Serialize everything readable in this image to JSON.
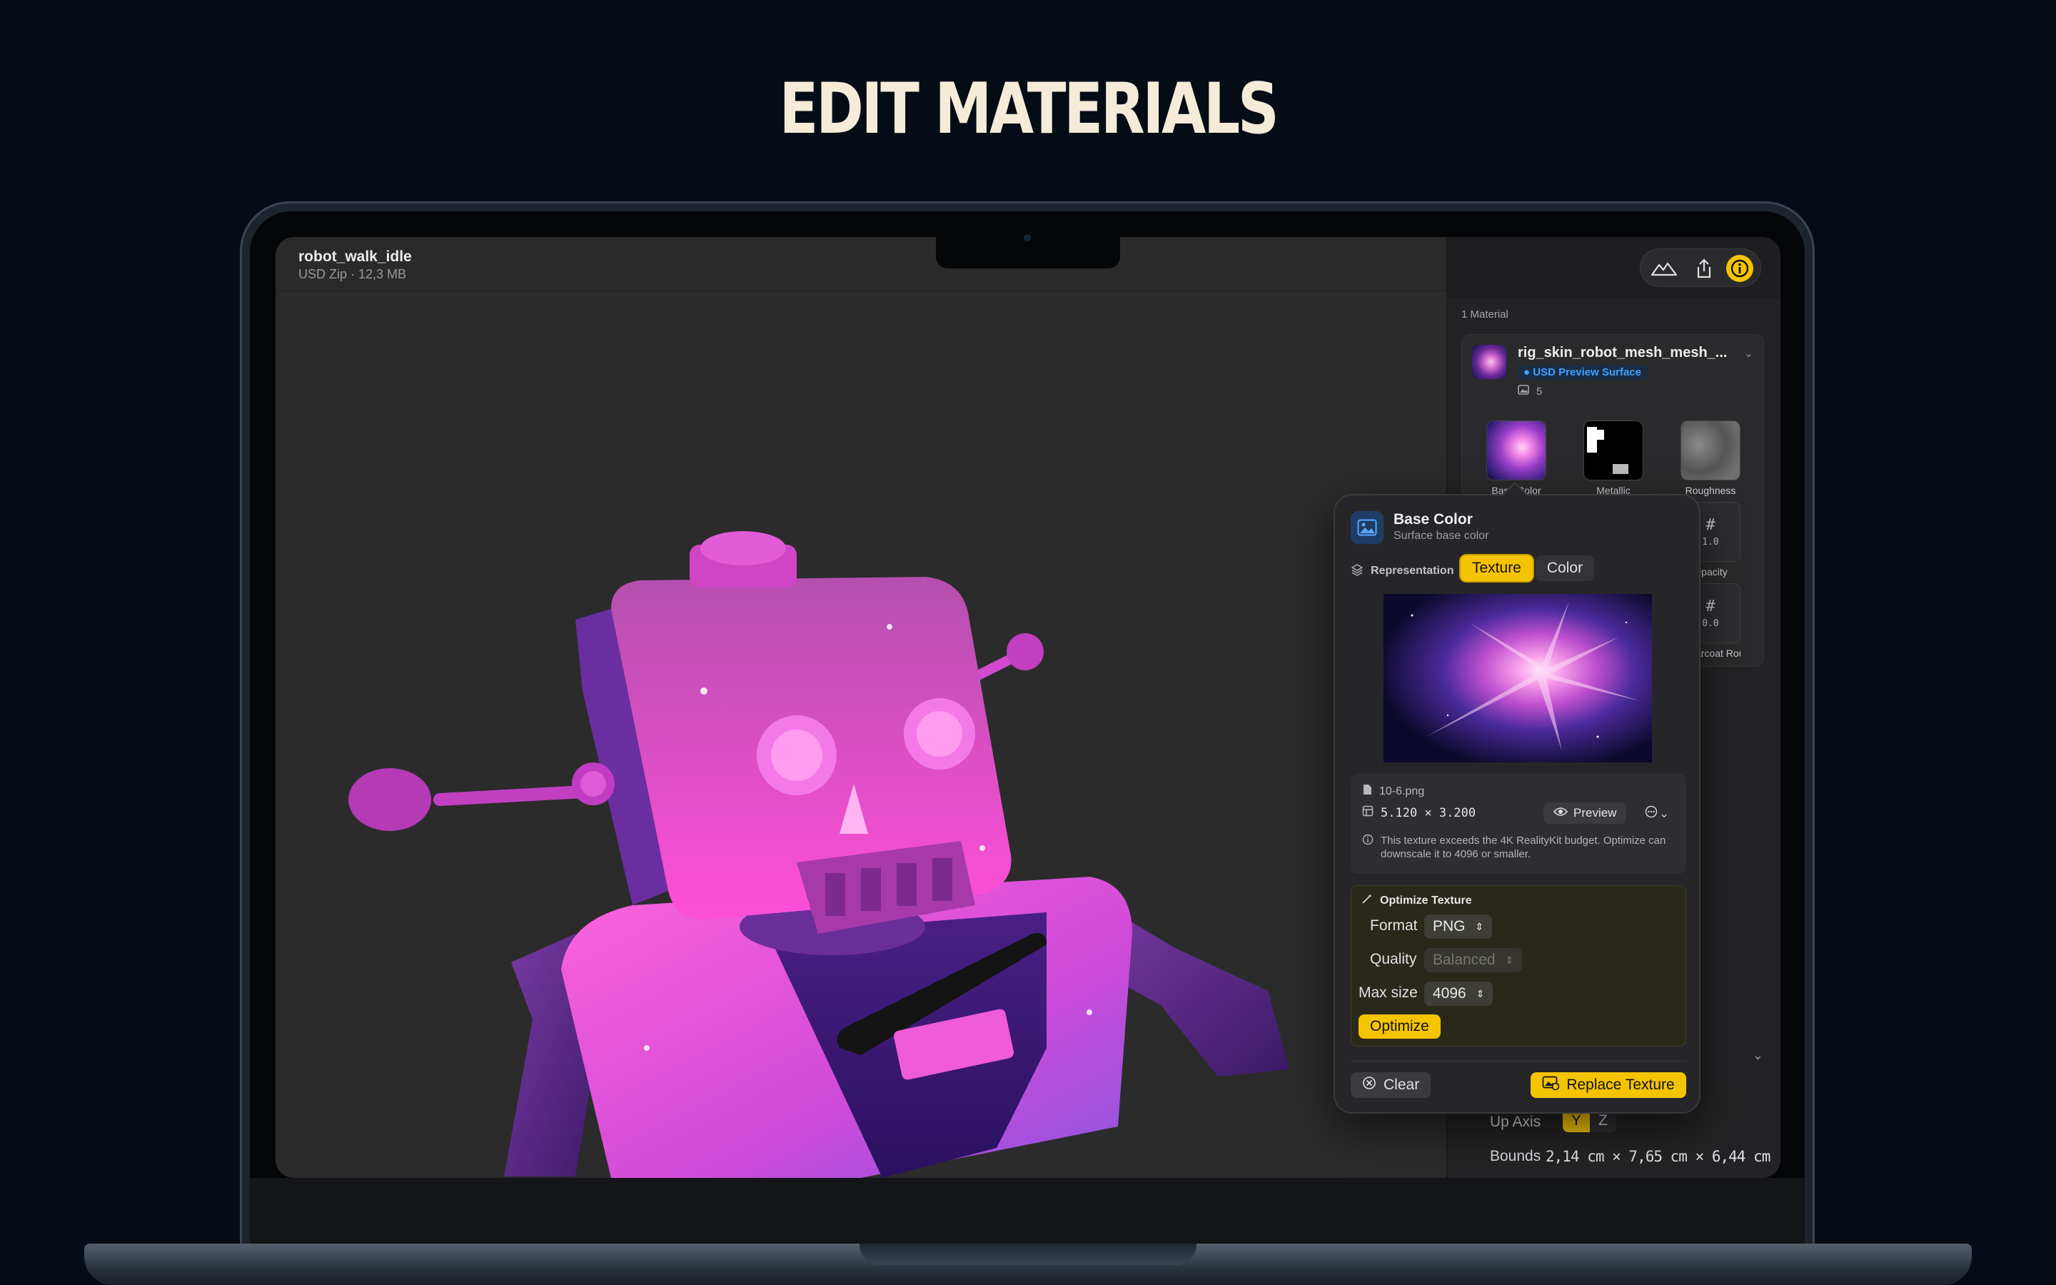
{
  "headline": "EDIT MATERIALS",
  "file": {
    "name": "robot_walk_idle",
    "meta": "USD Zip · 12,3 MB"
  },
  "toolbar": {
    "icons": [
      "mountains-icon",
      "share-icon",
      "info-icon"
    ]
  },
  "sidebar": {
    "material_count": "1 Material",
    "material": {
      "name": "rig_skin_robot_mesh_mesh_...",
      "badge": "USD Preview Surface",
      "texture_count": "5"
    },
    "textures": [
      {
        "label": "Base Color"
      },
      {
        "label": "Metallic"
      },
      {
        "label": "Roughness"
      },
      {
        "label": "Opacity",
        "value": "1.0"
      },
      {
        "label": "Clearcoat Roughness",
        "value": "0.0"
      }
    ],
    "up_axis": {
      "label": "Up Axis",
      "options": [
        "Y",
        "Z"
      ],
      "selected": "Y"
    },
    "bounds": {
      "label": "Bounds",
      "value": "2,14 cm × 7,65 cm × 6,44 cm"
    }
  },
  "popover": {
    "title": "Base Color",
    "subtitle": "Surface base color",
    "representation_label": "Representation",
    "representation_options": [
      "Texture",
      "Color"
    ],
    "representation_selected": "Texture",
    "file_name": "10-6.png",
    "dimensions": "5.120 × 3.200",
    "preview_label": "Preview",
    "warning": "This texture exceeds the 4K RealityKit budget. Optimize can downscale it to 4096 or smaller.",
    "optimize": {
      "title": "Optimize Texture",
      "format_label": "Format",
      "format_value": "PNG",
      "quality_label": "Quality",
      "quality_value": "Balanced",
      "max_size_label": "Max size",
      "max_size_value": "4096",
      "button": "Optimize"
    },
    "clear_label": "Clear",
    "replace_label": "Replace Texture"
  },
  "colors": {
    "accent": "#f5c400",
    "badge_blue": "#3ea2ff",
    "background": "#050c16"
  }
}
